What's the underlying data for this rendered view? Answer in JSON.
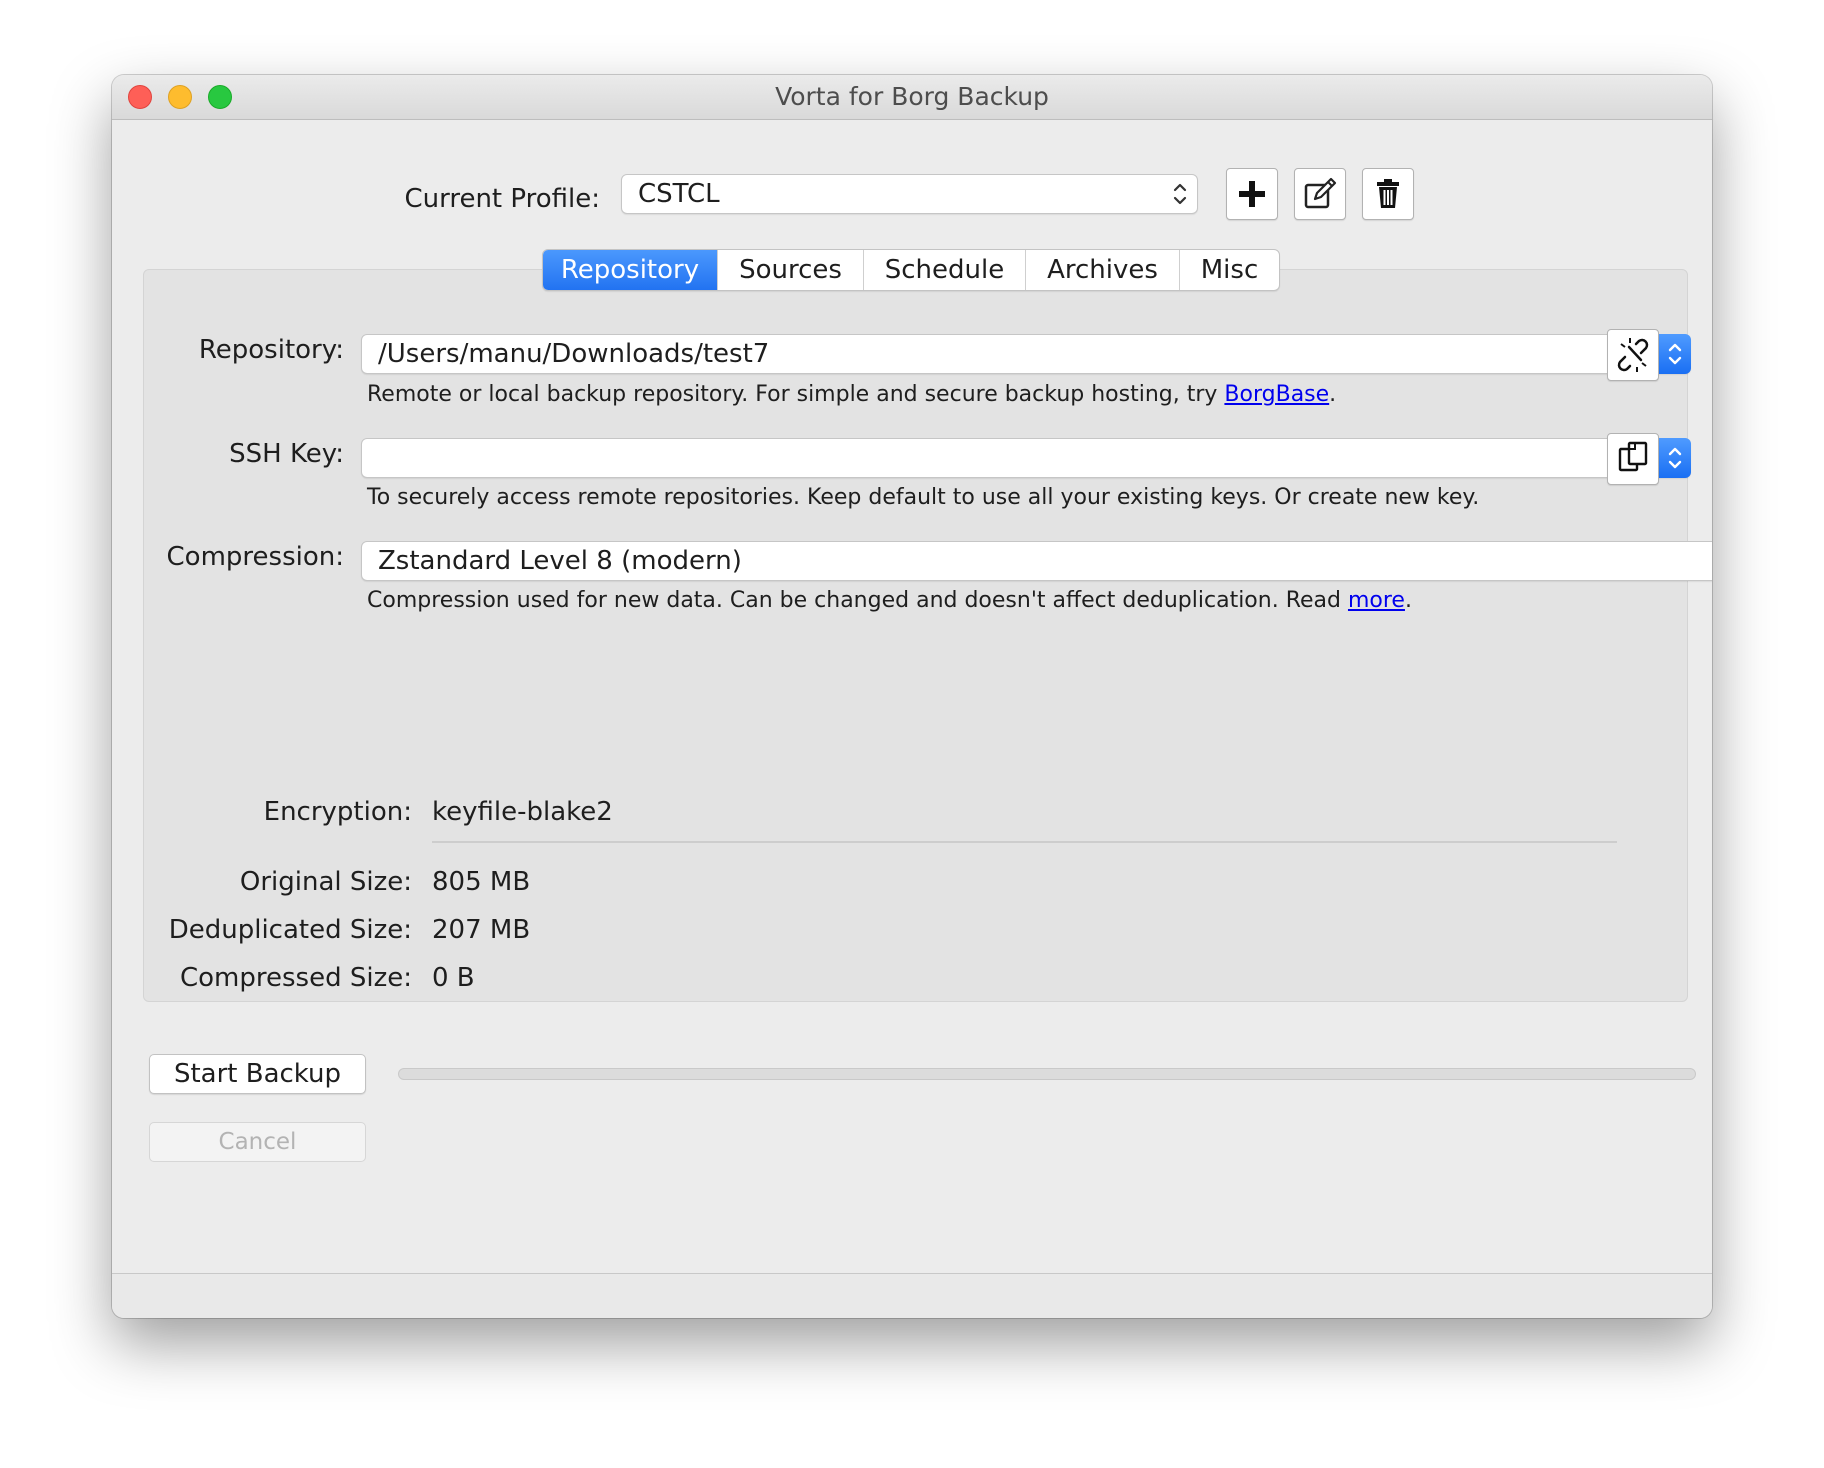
{
  "window": {
    "title": "Vorta for Borg Backup"
  },
  "profile": {
    "label": "Current Profile:",
    "selected": "CSTCL"
  },
  "toolbar": {
    "add_icon": "plus-icon",
    "edit_icon": "edit-icon",
    "delete_icon": "trash-icon"
  },
  "tabs": [
    {
      "label": "Repository",
      "active": true
    },
    {
      "label": "Sources",
      "active": false
    },
    {
      "label": "Schedule",
      "active": false
    },
    {
      "label": "Archives",
      "active": false
    },
    {
      "label": "Misc",
      "active": false
    }
  ],
  "repository": {
    "label": "Repository:",
    "value": "/Users/manu/Downloads/test7",
    "help_text": "Remote or local backup repository. For simple and secure backup hosting, try ",
    "help_link": "BorgBase",
    "help_suffix": ".",
    "action_icon": "unlink-icon"
  },
  "ssh_key": {
    "label": "SSH Key:",
    "value": "",
    "help_text": "To securely access remote repositories. Keep default to use all your existing keys. Or create new key.",
    "action_icon": "copy-icon"
  },
  "compression": {
    "label": "Compression:",
    "value": "Zstandard Level 8 (modern)",
    "help_text": "Compression used for new data. Can be changed and doesn't affect deduplication. Read ",
    "help_link": "more",
    "help_suffix": "."
  },
  "stats": {
    "encryption_label": "Encryption:",
    "encryption_value": "keyfile-blake2",
    "original_label": "Original Size:",
    "original_value": "805 MB",
    "dedup_label": "Deduplicated Size:",
    "dedup_value": "207 MB",
    "compressed_label": "Compressed Size:",
    "compressed_value": "0 B"
  },
  "actions": {
    "start_label": "Start Backup",
    "cancel_label": "Cancel",
    "progress": 0
  },
  "colors": {
    "accent": "#2273f1",
    "link": "#0000ee",
    "close": "#fe5f57",
    "minimize": "#febc2e",
    "maximize": "#28c840"
  }
}
